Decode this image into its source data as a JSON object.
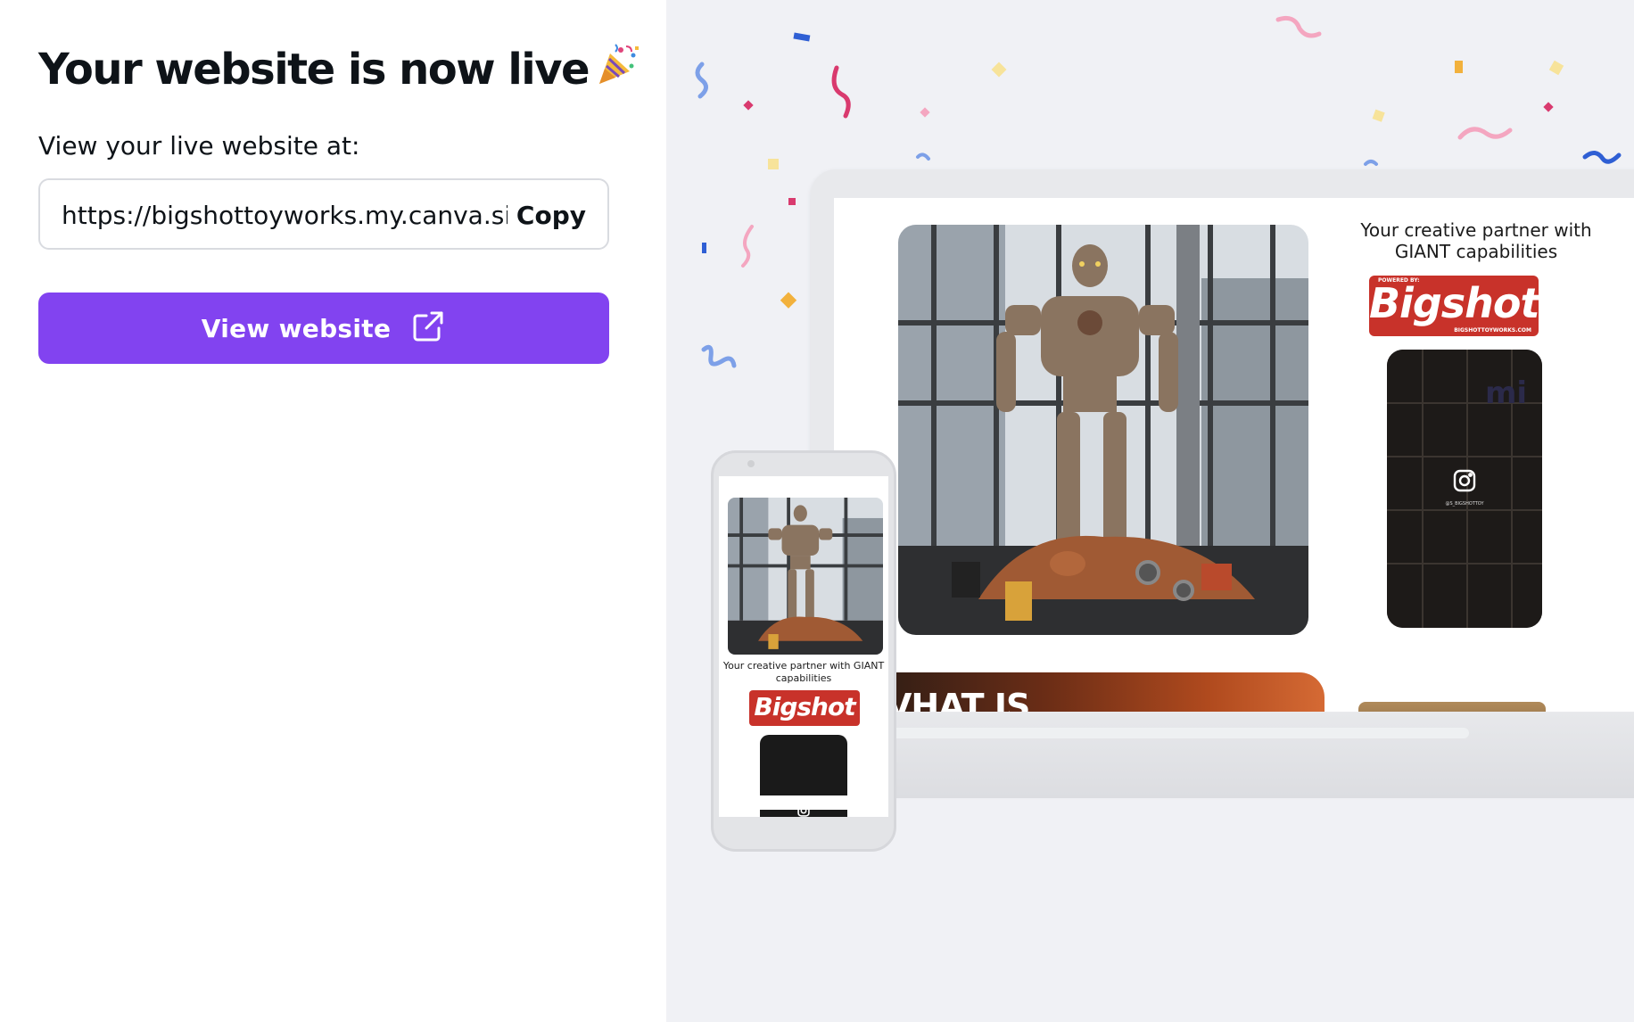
{
  "header": {
    "title": "Your website is now live",
    "title_icon": "party-popper-icon"
  },
  "live_url": {
    "label": "View your live website at:",
    "value": "https://bigshottoyworks.my.canva.sit",
    "copy_label": "Copy"
  },
  "view_button": {
    "label": "View website",
    "icon": "external-link-icon"
  },
  "preview": {
    "tagline": "Your creative partner with GIANT capabilities",
    "logo_small": "POWERED BY:",
    "logo": "Bigshot",
    "logo_url": "BIGSHOTTOYWORKS.COM",
    "instagram_handle": "@S_BIGSHOTTOY",
    "next_section_heading": "VHAT IS",
    "phone_tagline": "Your creative partner with GIANT capabilities"
  },
  "colors": {
    "accent": "#8243f0",
    "panel_bg": "#f0f1f5",
    "brand_red": "#c8322a"
  }
}
